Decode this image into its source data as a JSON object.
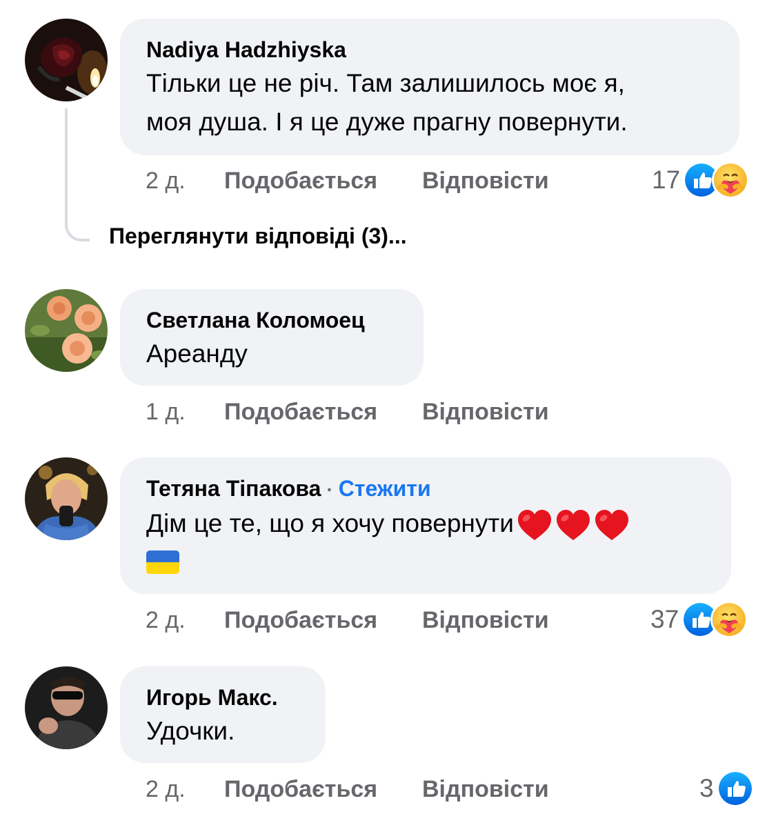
{
  "comments": [
    {
      "author": "Nadiya Hadzhiyska",
      "text_lines": [
        "Тільки це не річ. Там залишилось моє я,",
        "моя душа. І я це дуже прагну повернути."
      ],
      "time": "2 д.",
      "like_label": "Подобається",
      "reply_label": "Відповісти",
      "reaction_count": "17",
      "reactions": [
        "like-icon",
        "care-icon"
      ]
    },
    {
      "author": "Светлана Коломоец",
      "text_lines": [
        "Ареанду"
      ],
      "time": "1 д.",
      "like_label": "Подобається",
      "reply_label": "Відповісти"
    },
    {
      "author": "Тетяна Тіпакова",
      "separator": "·",
      "follow_label": "Стежити",
      "text_lines": [
        "Дім це те, що я хочу повернути"
      ],
      "emoji": [
        "heart-icon",
        "heart-icon",
        "heart-icon",
        "ukraine-flag-icon"
      ],
      "time": "2 д.",
      "like_label": "Подобається",
      "reply_label": "Відповісти",
      "reaction_count": "37",
      "reactions": [
        "like-icon",
        "care-icon"
      ]
    },
    {
      "author": "Игорь Макс.",
      "text_lines": [
        "Удочки."
      ],
      "time": "2 д.",
      "like_label": "Подобається",
      "reply_label": "Відповісти",
      "reaction_count": "3",
      "reactions": [
        "like-icon"
      ]
    }
  ],
  "view_replies": "Переглянути відповіді (3)...",
  "colors": {
    "bubble": "#f0f2f5",
    "meta_text": "#65676b",
    "follow": "#1877f2",
    "thread_line": "#d9dbe0"
  }
}
